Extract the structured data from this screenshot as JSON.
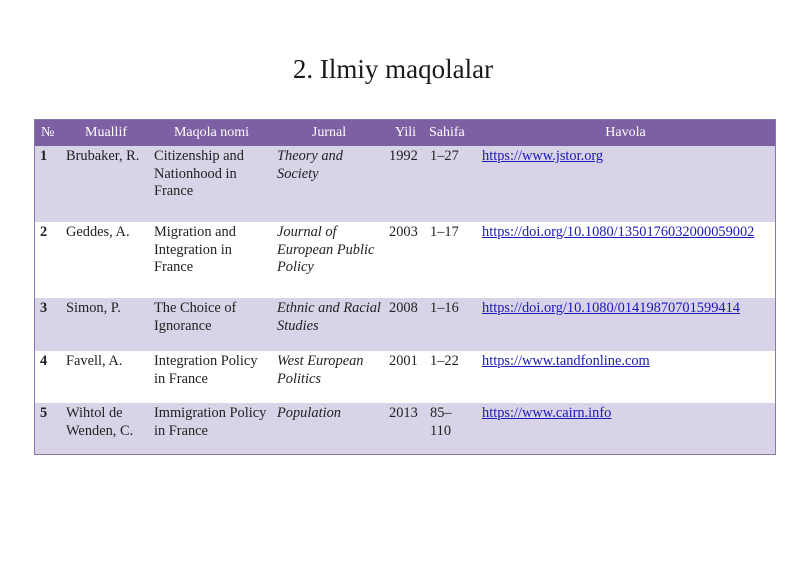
{
  "title": "2. Ilmiy maqolalar",
  "table": {
    "headers": [
      "№",
      "Muallif",
      "Maqola nomi",
      "Jurnal",
      "Yili",
      "Sahifa",
      "Havola"
    ],
    "rows": [
      {
        "num": "1",
        "author": "Brubaker, R.",
        "title": "Citizenship and Nationhood in France",
        "journal": "Theory and Society",
        "year": "1992",
        "pages": "1–27",
        "link": "https://www.jstor.org"
      },
      {
        "num": "2",
        "author": "Geddes, A.",
        "title": "Migration and Integration in France",
        "journal": "Journal of European Public Policy",
        "year": "2003",
        "pages": "1–17",
        "link": "https://doi.org/10.1080/1350176032000059002"
      },
      {
        "num": "3",
        "author": "Simon, P.",
        "title": "The Choice of Ignorance",
        "journal": "Ethnic and Racial Studies",
        "year": "2008",
        "pages": "1–16",
        "link": "https://doi.org/10.1080/01419870701599414"
      },
      {
        "num": "4",
        "author": "Favell, A.",
        "title": "Integration Policy in France",
        "journal": "West European Politics",
        "year": "2001",
        "pages": "1–22",
        "link": "https://www.tandfonline.com"
      },
      {
        "num": "5",
        "author": "Wihtol de Wenden, C.",
        "title": "Immigration Policy in France",
        "journal": "Population",
        "year": "2013",
        "pages": "85–110",
        "link": "https://www.cairn.info"
      }
    ]
  },
  "colors": {
    "header_bg": "#7d60a3",
    "row_shade": "#d9d3e7",
    "link": "#1a1ab8"
  }
}
